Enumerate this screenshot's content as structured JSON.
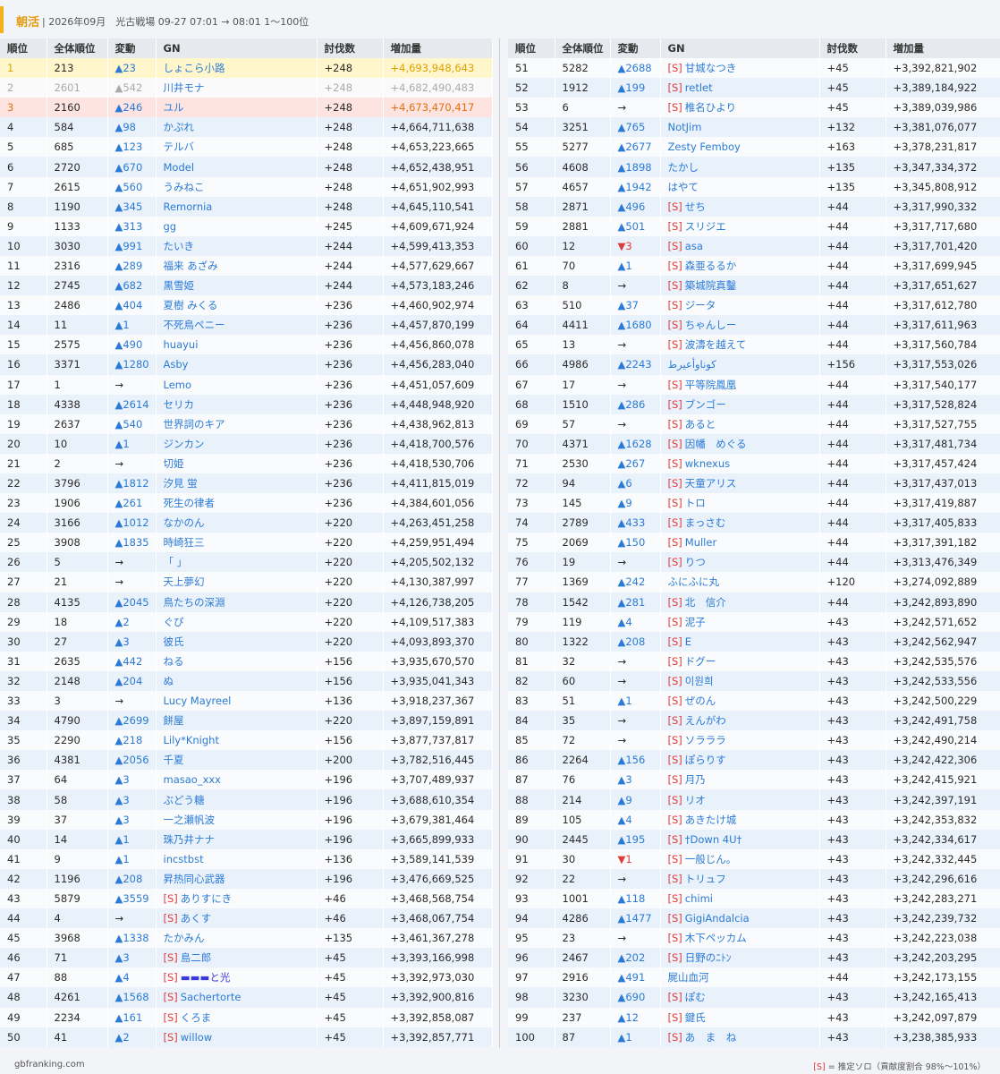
{
  "header": {
    "title": "朝活",
    "info": "| 2026年09月　光古戦場 09-27 07:01 → 08:01 1〜100位"
  },
  "columns": [
    "順位",
    "全体順位",
    "変動",
    "GN",
    "討伐数",
    "増加量"
  ],
  "solo_tag": "[S]",
  "rows_left": [
    [
      "1",
      "213",
      "▲23",
      "",
      "しょこら小路",
      "+248",
      "+4,693,948,643"
    ],
    [
      "2",
      "2601",
      "▲542",
      "",
      "川井モナ",
      "+248",
      "+4,682,490,483"
    ],
    [
      "3",
      "2160",
      "▲246",
      "",
      "ユル",
      "+248",
      "+4,673,470,417"
    ],
    [
      "4",
      "584",
      "▲98",
      "",
      "かぷれ",
      "+248",
      "+4,664,711,638"
    ],
    [
      "5",
      "685",
      "▲123",
      "",
      "テルバ",
      "+248",
      "+4,653,223,665"
    ],
    [
      "6",
      "2720",
      "▲670",
      "",
      "Model",
      "+248",
      "+4,652,438,951"
    ],
    [
      "7",
      "2615",
      "▲560",
      "",
      "うみねこ",
      "+248",
      "+4,651,902,993"
    ],
    [
      "8",
      "1190",
      "▲345",
      "",
      "Remornia",
      "+248",
      "+4,645,110,541"
    ],
    [
      "9",
      "1133",
      "▲313",
      "",
      "gg",
      "+245",
      "+4,609,671,924"
    ],
    [
      "10",
      "3030",
      "▲991",
      "",
      "たいき",
      "+244",
      "+4,599,413,353"
    ],
    [
      "11",
      "2316",
      "▲289",
      "",
      "福来 あざみ",
      "+244",
      "+4,577,629,667"
    ],
    [
      "12",
      "2745",
      "▲682",
      "",
      "黒雪姫",
      "+244",
      "+4,573,183,246"
    ],
    [
      "13",
      "2486",
      "▲404",
      "",
      "夏樹 みくる",
      "+236",
      "+4,460,902,974"
    ],
    [
      "14",
      "11",
      "▲1",
      "",
      "不死鳥ペニー",
      "+236",
      "+4,457,870,199"
    ],
    [
      "15",
      "2575",
      "▲490",
      "",
      "huayui",
      "+236",
      "+4,456,860,078"
    ],
    [
      "16",
      "3371",
      "▲1280",
      "",
      "Asby",
      "+236",
      "+4,456,283,040"
    ],
    [
      "17",
      "1",
      "→",
      "",
      "Lemo",
      "+236",
      "+4,451,057,609"
    ],
    [
      "18",
      "4338",
      "▲2614",
      "",
      "セリカ",
      "+236",
      "+4,448,948,920"
    ],
    [
      "19",
      "2637",
      "▲540",
      "",
      "世界詞のキア",
      "+236",
      "+4,438,962,813"
    ],
    [
      "20",
      "10",
      "▲1",
      "",
      "ジンカン",
      "+236",
      "+4,418,700,576"
    ],
    [
      "21",
      "2",
      "→",
      "",
      "切姫",
      "+236",
      "+4,418,530,706"
    ],
    [
      "22",
      "3796",
      "▲1812",
      "",
      "汐見 蛍",
      "+236",
      "+4,411,815,019"
    ],
    [
      "23",
      "1906",
      "▲261",
      "",
      "死生の律者",
      "+236",
      "+4,384,601,056"
    ],
    [
      "24",
      "3166",
      "▲1012",
      "",
      "なかのん",
      "+220",
      "+4,263,451,258"
    ],
    [
      "25",
      "3908",
      "▲1835",
      "",
      "時崎狂三",
      "+220",
      "+4,259,951,494"
    ],
    [
      "26",
      "5",
      "→",
      "",
      "「 」",
      "+220",
      "+4,205,502,132"
    ],
    [
      "27",
      "21",
      "→",
      "",
      "天上夢幻",
      "+220",
      "+4,130,387,997"
    ],
    [
      "28",
      "4135",
      "▲2045",
      "",
      "鳥たちの深淵",
      "+220",
      "+4,126,738,205"
    ],
    [
      "29",
      "18",
      "▲2",
      "",
      "ぐぴ",
      "+220",
      "+4,109,517,383"
    ],
    [
      "30",
      "27",
      "▲3",
      "",
      "彼氏",
      "+220",
      "+4,093,893,370"
    ],
    [
      "31",
      "2635",
      "▲442",
      "",
      "ねる",
      "+156",
      "+3,935,670,570"
    ],
    [
      "32",
      "2148",
      "▲204",
      "",
      "ぬ",
      "+156",
      "+3,935,041,343"
    ],
    [
      "33",
      "3",
      "→",
      "",
      "Lucy Mayreel",
      "+136",
      "+3,918,237,367"
    ],
    [
      "34",
      "4790",
      "▲2699",
      "",
      "餅屋",
      "+220",
      "+3,897,159,891"
    ],
    [
      "35",
      "2290",
      "▲218",
      "",
      "Lily*Knight",
      "+156",
      "+3,877,737,817"
    ],
    [
      "36",
      "4381",
      "▲2056",
      "",
      "千夏",
      "+200",
      "+3,782,516,445"
    ],
    [
      "37",
      "64",
      "▲3",
      "",
      "masao_xxx",
      "+196",
      "+3,707,489,937"
    ],
    [
      "38",
      "58",
      "▲3",
      "",
      "ぶどう糖",
      "+196",
      "+3,688,610,354"
    ],
    [
      "39",
      "37",
      "▲3",
      "",
      "一之瀬帆波",
      "+196",
      "+3,679,381,464"
    ],
    [
      "40",
      "14",
      "▲1",
      "",
      "珠乃井ナナ",
      "+196",
      "+3,665,899,933"
    ],
    [
      "41",
      "9",
      "▲1",
      "",
      "incstbst",
      "+136",
      "+3,589,141,539"
    ],
    [
      "42",
      "1196",
      "▲208",
      "",
      "昇热同心武器",
      "+196",
      "+3,476,669,525"
    ],
    [
      "43",
      "5879",
      "▲3559",
      "S",
      "ありすにき",
      "+46",
      "+3,468,568,754"
    ],
    [
      "44",
      "4",
      "→",
      "S",
      "あくす",
      "+46",
      "+3,468,067,754"
    ],
    [
      "45",
      "3968",
      "▲1338",
      "",
      "たかみん",
      "+135",
      "+3,461,367,278"
    ],
    [
      "46",
      "71",
      "▲3",
      "S",
      "島二郎",
      "+45",
      "+3,393,166,998"
    ],
    [
      "47",
      "88",
      "▲4",
      "S",
      "▬▬▬と光",
      "+45",
      "+3,392,973,030"
    ],
    [
      "48",
      "4261",
      "▲1568",
      "S",
      "Sachertorte",
      "+45",
      "+3,392,900,816"
    ],
    [
      "49",
      "2234",
      "▲161",
      "S",
      "くろま",
      "+45",
      "+3,392,858,087"
    ],
    [
      "50",
      "41",
      "▲2",
      "S",
      "willow",
      "+45",
      "+3,392,857,771"
    ]
  ],
  "rows_right": [
    [
      "51",
      "5282",
      "▲2688",
      "S",
      "甘城なつき",
      "+45",
      "+3,392,821,902"
    ],
    [
      "52",
      "1912",
      "▲199",
      "S",
      "retlet",
      "+45",
      "+3,389,184,922"
    ],
    [
      "53",
      "6",
      "→",
      "S",
      "椎名ひより",
      "+45",
      "+3,389,039,986"
    ],
    [
      "54",
      "3251",
      "▲765",
      "",
      "NotJim",
      "+132",
      "+3,381,076,077"
    ],
    [
      "55",
      "5277",
      "▲2677",
      "",
      "Zesty Femboy",
      "+163",
      "+3,378,231,817"
    ],
    [
      "56",
      "4608",
      "▲1898",
      "",
      "たかし",
      "+135",
      "+3,347,334,372"
    ],
    [
      "57",
      "4657",
      "▲1942",
      "",
      "はやて",
      "+135",
      "+3,345,808,912"
    ],
    [
      "58",
      "2871",
      "▲496",
      "S",
      "せち",
      "+44",
      "+3,317,990,332"
    ],
    [
      "59",
      "2881",
      "▲501",
      "S",
      "スリジエ",
      "+44",
      "+3,317,717,680"
    ],
    [
      "60",
      "12",
      "▼3",
      "S",
      "asa",
      "+44",
      "+3,317,701,420"
    ],
    [
      "61",
      "70",
      "▲1",
      "S",
      "森亜るるか",
      "+44",
      "+3,317,699,945"
    ],
    [
      "62",
      "8",
      "→",
      "S",
      "築城院真鑿",
      "+44",
      "+3,317,651,627"
    ],
    [
      "63",
      "510",
      "▲37",
      "S",
      "ジータ",
      "+44",
      "+3,317,612,780"
    ],
    [
      "64",
      "4411",
      "▲1680",
      "S",
      "ちゃんしー",
      "+44",
      "+3,317,611,963"
    ],
    [
      "65",
      "13",
      "→",
      "S",
      "波濤を越えて",
      "+44",
      "+3,317,560,784"
    ],
    [
      "66",
      "4986",
      "▲2243",
      "",
      "كوناوأعيرط",
      "+156",
      "+3,317,553,026"
    ],
    [
      "67",
      "17",
      "→",
      "S",
      "平等院鳳凰",
      "+44",
      "+3,317,540,177"
    ],
    [
      "68",
      "1510",
      "▲286",
      "S",
      "ブンゴー",
      "+44",
      "+3,317,528,824"
    ],
    [
      "69",
      "57",
      "→",
      "S",
      "あると",
      "+44",
      "+3,317,527,755"
    ],
    [
      "70",
      "4371",
      "▲1628",
      "S",
      "因幡　めぐる",
      "+44",
      "+3,317,481,734"
    ],
    [
      "71",
      "2530",
      "▲267",
      "S",
      "wknexus",
      "+44",
      "+3,317,457,424"
    ],
    [
      "72",
      "94",
      "▲6",
      "S",
      "天童アリス",
      "+44",
      "+3,317,437,013"
    ],
    [
      "73",
      "145",
      "▲9",
      "S",
      "トロ",
      "+44",
      "+3,317,419,887"
    ],
    [
      "74",
      "2789",
      "▲433",
      "S",
      "まっさむ",
      "+44",
      "+3,317,405,833"
    ],
    [
      "75",
      "2069",
      "▲150",
      "S",
      "Muller",
      "+44",
      "+3,317,391,182"
    ],
    [
      "76",
      "19",
      "→",
      "S",
      "りつ",
      "+44",
      "+3,313,476,349"
    ],
    [
      "77",
      "1369",
      "▲242",
      "",
      "ふにふに丸",
      "+120",
      "+3,274,092,889"
    ],
    [
      "78",
      "1542",
      "▲281",
      "S",
      "北　信介",
      "+44",
      "+3,242,893,890"
    ],
    [
      "79",
      "119",
      "▲4",
      "S",
      "泥子",
      "+43",
      "+3,242,571,652"
    ],
    [
      "80",
      "1322",
      "▲208",
      "S",
      "E",
      "+43",
      "+3,242,562,947"
    ],
    [
      "81",
      "32",
      "→",
      "S",
      "ドグー",
      "+43",
      "+3,242,535,576"
    ],
    [
      "82",
      "60",
      "→",
      "S",
      "이원희",
      "+43",
      "+3,242,533,556"
    ],
    [
      "83",
      "51",
      "▲1",
      "S",
      "ぜのん",
      "+43",
      "+3,242,500,229"
    ],
    [
      "84",
      "35",
      "→",
      "S",
      "えんがわ",
      "+43",
      "+3,242,491,758"
    ],
    [
      "85",
      "72",
      "→",
      "S",
      "ソラララ",
      "+43",
      "+3,242,490,214"
    ],
    [
      "86",
      "2264",
      "▲156",
      "S",
      "ぽらりす",
      "+43",
      "+3,242,422,306"
    ],
    [
      "87",
      "76",
      "▲3",
      "S",
      "月乃",
      "+43",
      "+3,242,415,921"
    ],
    [
      "88",
      "214",
      "▲9",
      "S",
      "リオ",
      "+43",
      "+3,242,397,191"
    ],
    [
      "89",
      "105",
      "▲4",
      "S",
      "あきたけ城",
      "+43",
      "+3,242,353,832"
    ],
    [
      "90",
      "2445",
      "▲195",
      "S",
      "†Down 4U†",
      "+43",
      "+3,242,334,617"
    ],
    [
      "91",
      "30",
      "▼1",
      "S",
      "一般じん。",
      "+43",
      "+3,242,332,445"
    ],
    [
      "92",
      "22",
      "→",
      "S",
      "トリュフ",
      "+43",
      "+3,242,296,616"
    ],
    [
      "93",
      "1001",
      "▲118",
      "S",
      "chimi",
      "+43",
      "+3,242,283,271"
    ],
    [
      "94",
      "4286",
      "▲1477",
      "S",
      "GigiAndalcia",
      "+43",
      "+3,242,239,732"
    ],
    [
      "95",
      "23",
      "→",
      "S",
      "木下ペッカム",
      "+43",
      "+3,242,223,038"
    ],
    [
      "96",
      "2467",
      "▲202",
      "S",
      "日野のﾆﾄﾝ",
      "+43",
      "+3,242,203,295"
    ],
    [
      "97",
      "2916",
      "▲491",
      "",
      "屍山血河",
      "+44",
      "+3,242,173,155"
    ],
    [
      "98",
      "3230",
      "▲690",
      "S",
      "ぽむ",
      "+43",
      "+3,242,165,413"
    ],
    [
      "99",
      "237",
      "▲12",
      "S",
      "鍵氏",
      "+43",
      "+3,242,097,879"
    ],
    [
      "100",
      "87",
      "▲1",
      "S",
      "あ　ま　ね",
      "+43",
      "+3,238,385,933"
    ]
  ],
  "footer": {
    "site": "gbfranking.com",
    "legend_tag": "[S]",
    "legend_text": " = 推定ソロ（貢献度割合 98%〜101%）"
  },
  "colors": {
    "accent": "#f3b21a",
    "name_link": "#2b7bd6",
    "up": "#2b7bd6",
    "down": "#e03b3b",
    "solo": "#e03b3b",
    "gold_row": "#fff6cc",
    "bronze_row": "#fde4e1"
  }
}
